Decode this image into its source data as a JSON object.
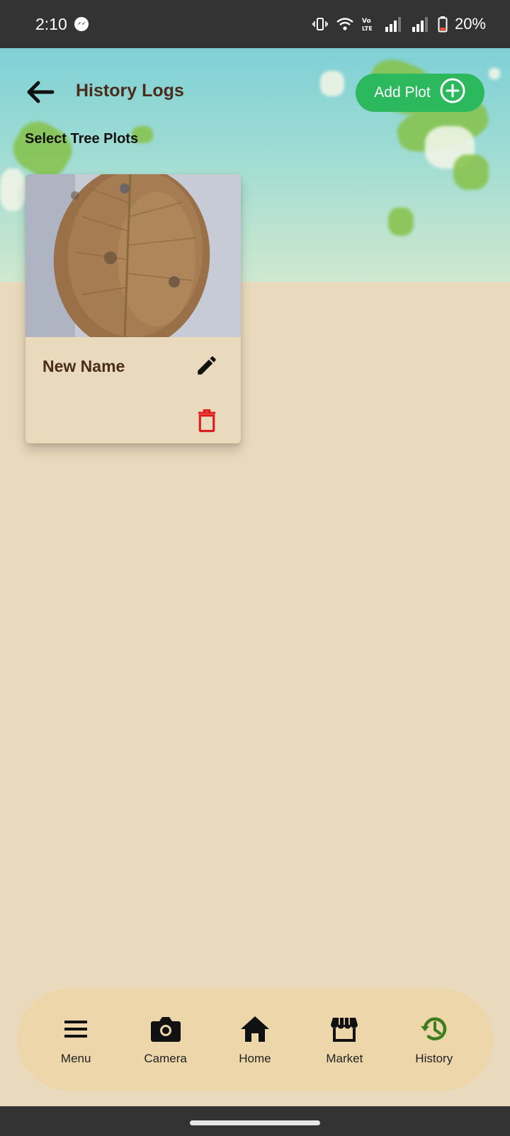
{
  "status_bar": {
    "time": "2:10",
    "battery": "20%",
    "icons": [
      "messenger-icon",
      "vibrate-icon",
      "wifi-icon",
      "volte-icon",
      "signal-icon",
      "signal-icon",
      "battery-icon"
    ]
  },
  "header": {
    "title": "History Logs",
    "add_button_label": "Add Plot",
    "subtitle": "Select Tree Plots"
  },
  "plots": [
    {
      "name": "New Name",
      "image": "leaf-photo"
    }
  ],
  "bottom_nav": {
    "items": [
      {
        "label": "Menu",
        "icon": "menu-icon"
      },
      {
        "label": "Camera",
        "icon": "camera-icon"
      },
      {
        "label": "Home",
        "icon": "home-icon"
      },
      {
        "label": "Market",
        "icon": "store-icon"
      },
      {
        "label": "History",
        "icon": "history-icon"
      }
    ],
    "active": "History"
  },
  "colors": {
    "accent_green": "#2cb85c",
    "title_brown": "#4a2c1c",
    "background": "#e9dabd",
    "nav_background": "#ecd6aa",
    "delete_red": "#e01b1b",
    "history_green": "#3e7d1e"
  }
}
